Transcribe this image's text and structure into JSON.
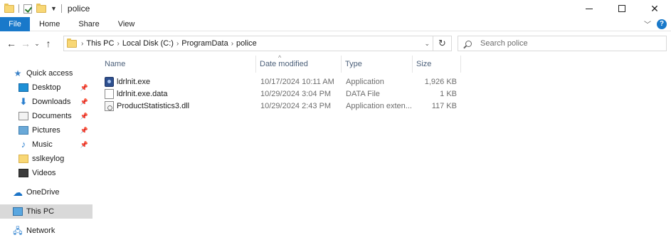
{
  "window": {
    "title": "police",
    "controls": {
      "minimize": "minimize",
      "maximize": "maximize",
      "close": "✕"
    }
  },
  "ribbon": {
    "tabs": [
      "File",
      "Home",
      "Share",
      "View"
    ],
    "help": "?"
  },
  "address": {
    "crumbs": [
      "This PC",
      "Local Disk (C:)",
      "ProgramData",
      "police"
    ]
  },
  "search": {
    "placeholder": "Search police"
  },
  "nav_pane": {
    "items": [
      {
        "label": "Quick access",
        "icon": "star-icon",
        "pinned": false
      },
      {
        "label": "Desktop",
        "icon": "desktop-icon",
        "pinned": true
      },
      {
        "label": "Downloads",
        "icon": "downloads-icon",
        "pinned": true
      },
      {
        "label": "Documents",
        "icon": "documents-icon",
        "pinned": true
      },
      {
        "label": "Pictures",
        "icon": "pictures-icon",
        "pinned": true
      },
      {
        "label": "Music",
        "icon": "music-icon",
        "pinned": true
      },
      {
        "label": "sslkeylog",
        "icon": "folder-icon",
        "pinned": false
      },
      {
        "label": "Videos",
        "icon": "videos-icon",
        "pinned": false
      },
      {
        "label": "OneDrive",
        "icon": "cloud-icon",
        "pinned": false
      },
      {
        "label": "This PC",
        "icon": "computer-icon",
        "pinned": false,
        "selected": true
      },
      {
        "label": "Network",
        "icon": "network-icon",
        "pinned": false
      }
    ]
  },
  "file_list": {
    "columns": [
      "Name",
      "Date modified",
      "Type",
      "Size"
    ],
    "rows": [
      {
        "name": "ldrlnit.exe",
        "date": "10/17/2024 10:11 AM",
        "type": "Application",
        "size": "1,926 KB",
        "icon": "exe-icon"
      },
      {
        "name": "ldrlnit.exe.data",
        "date": "10/29/2024 3:04 PM",
        "type": "DATA File",
        "size": "1 KB",
        "icon": "data-file-icon"
      },
      {
        "name": "ProductStatistics3.dll",
        "date": "10/29/2024 2:43 PM",
        "type": "Application exten...",
        "size": "117 KB",
        "icon": "dll-icon"
      }
    ]
  },
  "colors": {
    "accent": "#1979ca",
    "selection": "#d9d9d9",
    "header_text": "#4c607a"
  }
}
